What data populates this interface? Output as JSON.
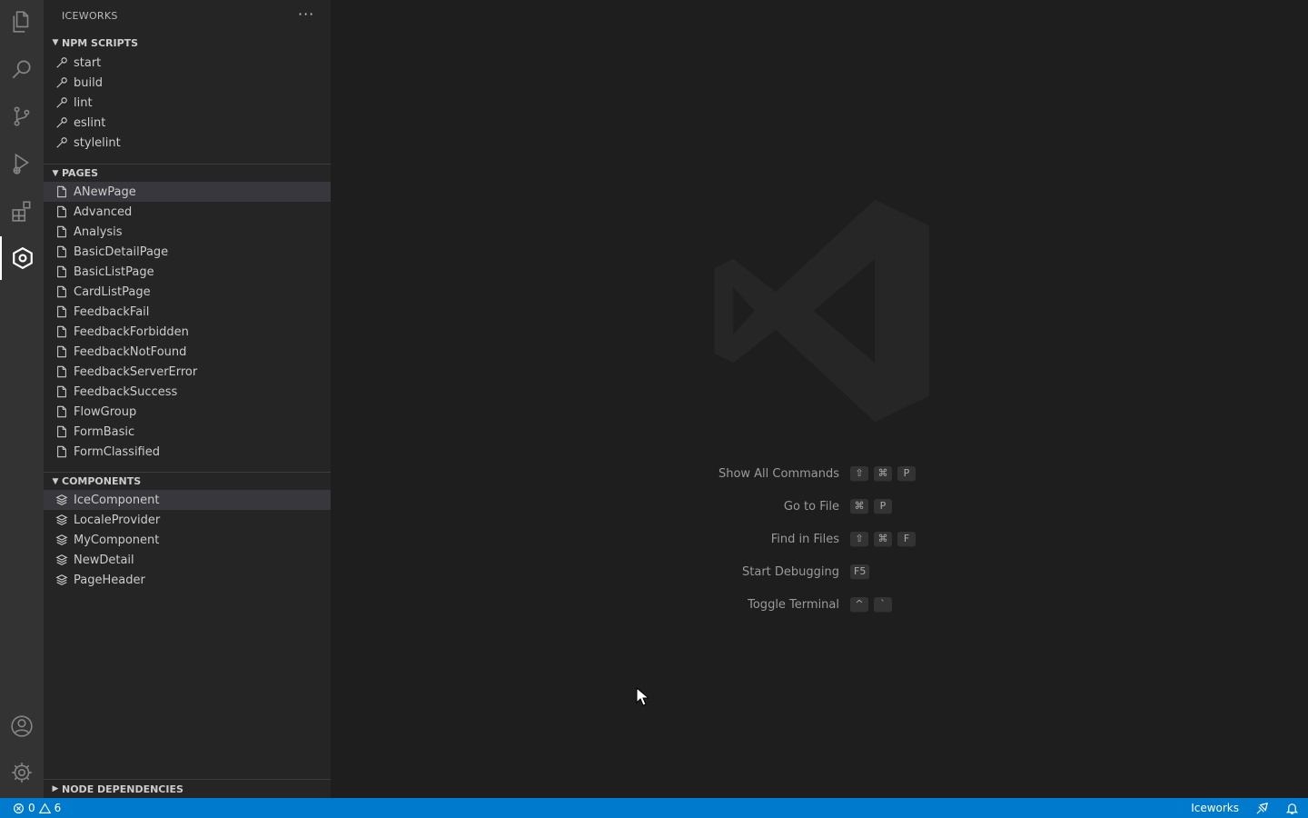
{
  "sidebar": {
    "title": "ICEWORKS",
    "more_label": "···",
    "npm_scripts": {
      "header": "NPM SCRIPTS",
      "items": [
        "start",
        "build",
        "lint",
        "eslint",
        "stylelint"
      ]
    },
    "pages": {
      "header": "PAGES",
      "items": [
        "ANewPage",
        "Advanced",
        "Analysis",
        "BasicDetailPage",
        "BasicListPage",
        "CardListPage",
        "FeedbackFail",
        "FeedbackForbidden",
        "FeedbackNotFound",
        "FeedbackServerError",
        "FeedbackSuccess",
        "FlowGroup",
        "FormBasic",
        "FormClassified"
      ]
    },
    "components": {
      "header": "COMPONENTS",
      "items": [
        "IceComponent",
        "LocaleProvider",
        "MyComponent",
        "NewDetail",
        "PageHeader"
      ]
    },
    "node_dependencies": {
      "header": "NODE DEPENDENCIES"
    }
  },
  "activity_bar": {
    "icons": [
      "files-icon",
      "search-icon",
      "source-control-icon",
      "run-debug-icon",
      "extensions-icon",
      "iceworks-icon",
      "account-icon",
      "settings-gear-icon"
    ]
  },
  "editor": {
    "commands": [
      {
        "label": "Show All Commands",
        "keys": [
          "⇧",
          "⌘",
          "P"
        ]
      },
      {
        "label": "Go to File",
        "keys": [
          "⌘",
          "P"
        ]
      },
      {
        "label": "Find in Files",
        "keys": [
          "⇧",
          "⌘",
          "F"
        ]
      },
      {
        "label": "Start Debugging",
        "keys": [
          "F5"
        ]
      },
      {
        "label": "Toggle Terminal",
        "keys": [
          "^",
          "`"
        ]
      }
    ]
  },
  "status_bar": {
    "errors": "0",
    "warnings": "6",
    "extension_label": "Iceworks",
    "background_color": "#007acc"
  }
}
